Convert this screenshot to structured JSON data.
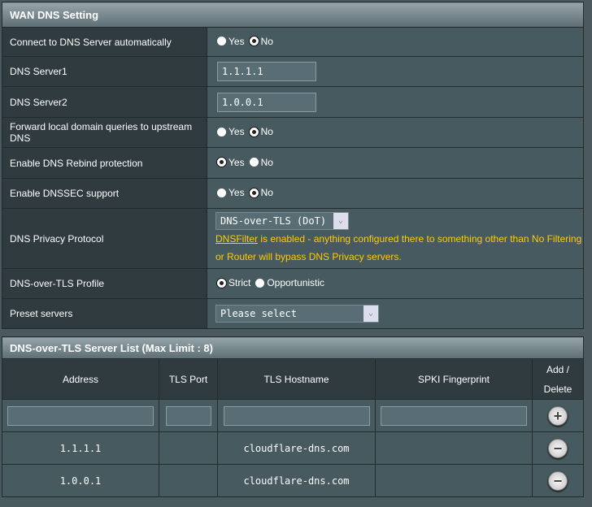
{
  "wan_dns": {
    "title": "WAN DNS Setting",
    "rows": {
      "auto": {
        "label": "Connect to DNS Server automatically",
        "yes": "Yes",
        "no": "No",
        "selected": "No"
      },
      "dns1": {
        "label": "DNS Server1",
        "value": "1.1.1.1"
      },
      "dns2": {
        "label": "DNS Server2",
        "value": "1.0.0.1"
      },
      "forward": {
        "label": "Forward local domain queries to upstream DNS",
        "yes": "Yes",
        "no": "No",
        "selected": "No"
      },
      "rebind": {
        "label": "Enable DNS Rebind protection",
        "yes": "Yes",
        "no": "No",
        "selected": "Yes"
      },
      "dnssec": {
        "label": "Enable DNSSEC support",
        "yes": "Yes",
        "no": "No",
        "selected": "No"
      },
      "privacy": {
        "label": "DNS Privacy Protocol",
        "value": "DNS-over-TLS (DoT)",
        "link": "DNSFilter",
        "warning": " is enabled - anything configured there to something other than No Filtering or Router will bypass DNS Privacy servers."
      },
      "profile": {
        "label": "DNS-over-TLS Profile",
        "strict": "Strict",
        "opportunistic": "Opportunistic",
        "selected": "Strict"
      },
      "preset": {
        "label": "Preset servers",
        "value": "Please select"
      }
    }
  },
  "server_list": {
    "title": "DNS-over-TLS Server List (Max Limit : 8)",
    "columns": [
      "Address",
      "TLS Port",
      "TLS Hostname",
      "SPKI Fingerprint",
      "Add / Delete"
    ],
    "rows": [
      {
        "address": "1.1.1.1",
        "port": "",
        "hostname": "cloudflare-dns.com",
        "spki": ""
      },
      {
        "address": "1.0.0.1",
        "port": "",
        "hostname": "cloudflare-dns.com",
        "spki": ""
      }
    ],
    "warning_color": "#ffcc00"
  }
}
